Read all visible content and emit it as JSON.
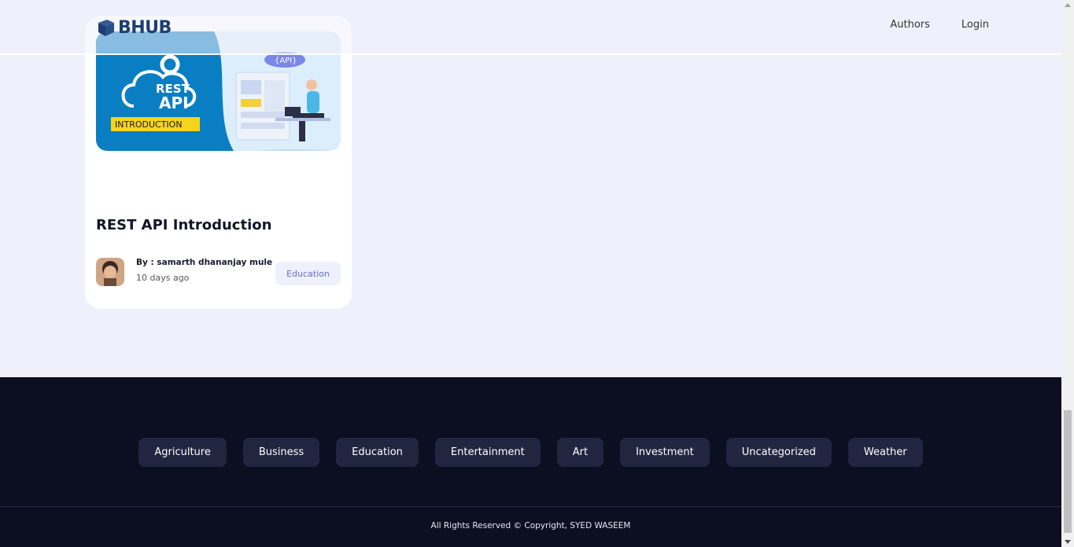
{
  "header": {
    "logo_text": "BHUB",
    "nav": {
      "authors": "Authors",
      "login": "Login"
    }
  },
  "post": {
    "image": {
      "cloud_text_1": "REST",
      "cloud_text_2": "API",
      "banner": "INTRODUCTION",
      "api_bubble": "{API}"
    },
    "title": "REST API Introduction",
    "author": "By : samarth dhananjay mule",
    "date": "10 days ago",
    "category": "Education"
  },
  "footer": {
    "categories": [
      "Agriculture",
      "Business",
      "Education",
      "Entertainment",
      "Art",
      "Investment",
      "Uncategorized",
      "Weather"
    ],
    "copyright": "All Rights Reserved © Copyright, SYED WASEEM"
  },
  "colors": {
    "background": "#f0f0fc",
    "footer": "#0c0e22",
    "category_pill": "#222540",
    "tag_text": "#6670c9"
  }
}
